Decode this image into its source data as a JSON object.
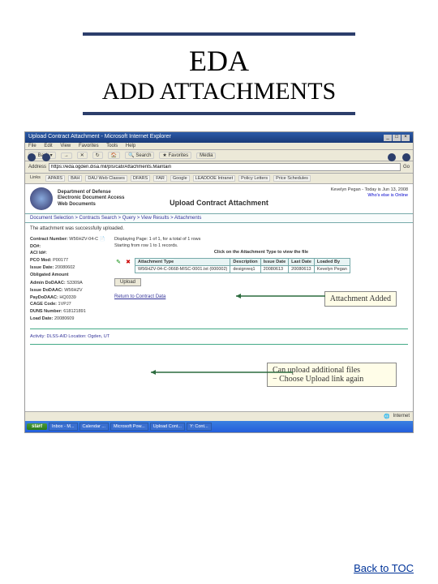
{
  "title_line1": "EDA",
  "title_line2": "ADD ATTACHMENTS",
  "browser": {
    "title": "Upload Contract Attachment - Microsoft Internet Explorer",
    "menu": [
      "File",
      "Edit",
      "View",
      "Favorites",
      "Tools",
      "Help"
    ],
    "toolbar": {
      "back": "Back",
      "search": "Search",
      "favorites": "Favorites",
      "media": "Media"
    },
    "address_label": "Address",
    "address_value": "https://eda.ogden.disa.mil/pls/cati/Attachments.Maintain",
    "go": "Go",
    "links_label": "Links",
    "links": [
      "APARS",
      "BAH",
      "DAU Web Classes",
      "DFARS",
      "FAR",
      "Google",
      "LEADDOE Intranet",
      "Policy Letters",
      "Price Schedules"
    ]
  },
  "page": {
    "org1": "Department of Defense",
    "org2": "Electronic Document Access",
    "org3": "Web Documents",
    "heading": "Upload Contract Attachment",
    "user": "Kevelyn Pegan - Today is Jun 13, 2008",
    "whos_online": "Who's else is Online",
    "breadcrumb": "Document Selection > Contracts Search > Query > View Results > Attachments",
    "msg": "The attachment was successfully uploaded.",
    "left": {
      "contract_lbl": "Contract Number:",
      "contract_val": "W56HZV-04-C",
      "do_lbl": "DO#:",
      "do_val": "",
      "aci_lbl": "ACI Id#:",
      "aci_val": "",
      "pco_lbl": "PCO Mod:",
      "pco_val": "P00177",
      "issue_lbl": "Issue Date:",
      "issue_val": "20080602",
      "ob_hdr": "Obligated Amount",
      "admin_lbl": "Admin DoDAAC:",
      "admin_val": "S3309A",
      "issueby_lbl": "Issue DoDAAC:",
      "issueby_val": "W56HZV",
      "pay_lbl": "PayDoDAAC:",
      "pay_val": "HQ0339",
      "cage_lbl": "CAGE Code:",
      "cage_val": "1VPJ7",
      "duns_lbl": "DUNS Number:",
      "duns_val": "618121891",
      "load_lbl": "Load Date:",
      "load_val": "20080609"
    },
    "right_note1": "Displaying Page: 1 of 1, for a total of 1 rows",
    "right_note2": "Starting from row 1 to 1 records.",
    "right_instruction": "Click on the Attachment Type to view the file",
    "table": {
      "h1": "Attachment Type",
      "h2": "Description",
      "h3": "Issue Date",
      "h4": "Last Date",
      "h5": "Loaded By",
      "r1c1": "W56HZV-04-C-0668-MISC-0001.txt (000002)",
      "r1c2": "designreq1",
      "r1c3": "20080613",
      "r1c4": "20080613",
      "r1c5": "Kevelyn Pegan"
    },
    "upload_btn": "Upload",
    "return_link": "Return to Contract Data",
    "footer": "Activity: DLSS-AID Location: Ogden, UT"
  },
  "statusbar": {
    "done": "Internet"
  },
  "taskbar": {
    "start": "start",
    "items": [
      "Inbox - M...",
      "Calendar ...",
      "Microsoft Pow...",
      "Upload Cont...",
      "Y: Cont..."
    ]
  },
  "callouts": {
    "c1": "Attachment Added",
    "c2a": "Can upload additional files",
    "c2b": "− Choose Upload link again"
  },
  "bottom_link": "Back to TOC"
}
